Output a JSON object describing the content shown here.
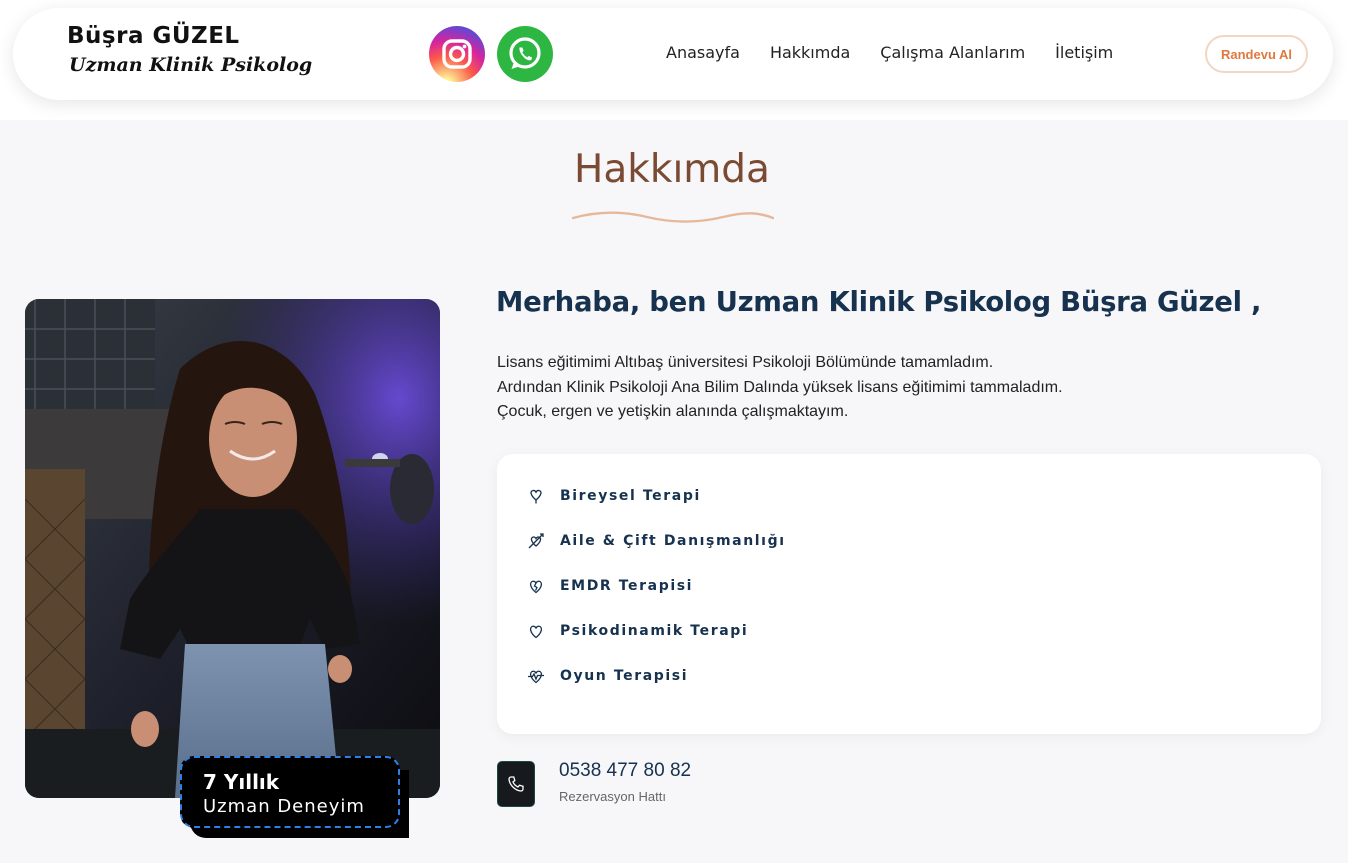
{
  "header": {
    "brand_name": "Büşra GÜZEL",
    "brand_subtitle": "Uzman Klinik Psikolog",
    "social": [
      {
        "name": "instagram",
        "icon": "instagram-icon"
      },
      {
        "name": "whatsapp",
        "icon": "whatsapp-icon"
      }
    ],
    "nav": [
      {
        "label": "Anasayfa"
      },
      {
        "label": "Hakkımda"
      },
      {
        "label": "Çalışma Alanlarım"
      },
      {
        "label": "İletişim"
      }
    ],
    "cta_label": "Randevu Al"
  },
  "about": {
    "title": "Hakkımda",
    "headline": "Merhaba, ben Uzman Klinik Psikolog Büşra Güzel ,",
    "bio": [
      "Lisans eğitimimi Altıbaş üniversitesi Psikoloji Bölümünde tamamladım.",
      "Ardından Klinik Psikoloji Ana Bilim Dalında yüksek lisans eğitimimi tammaladım.",
      "Çocuk, ergen ve yetişkin alanında çalışmaktayım."
    ],
    "experience_badge": {
      "years": "7 Yıllık",
      "label": "Uzman Deneyim"
    },
    "services": [
      {
        "label": "Bireysel Terapi",
        "icon": "heart-pin-icon"
      },
      {
        "label": "Aile & Çift Danışmanlığı",
        "icon": "heart-arrow-icon"
      },
      {
        "label": "EMDR Terapisi",
        "icon": "broken-heart-icon"
      },
      {
        "label": "Psikodinamik Terapi",
        "icon": "heart-icon"
      },
      {
        "label": "Oyun Terapisi",
        "icon": "heartbeat-icon"
      }
    ],
    "contact": {
      "phone": "0538 477 80 82",
      "caption": "Rezervasyon Hattı",
      "icon": "phone-icon"
    }
  },
  "colors": {
    "accent": "#e0783f",
    "title": "#7a4a33",
    "heading": "#16324f",
    "badge_border": "#2f7fe8",
    "whatsapp": "#2db742"
  }
}
